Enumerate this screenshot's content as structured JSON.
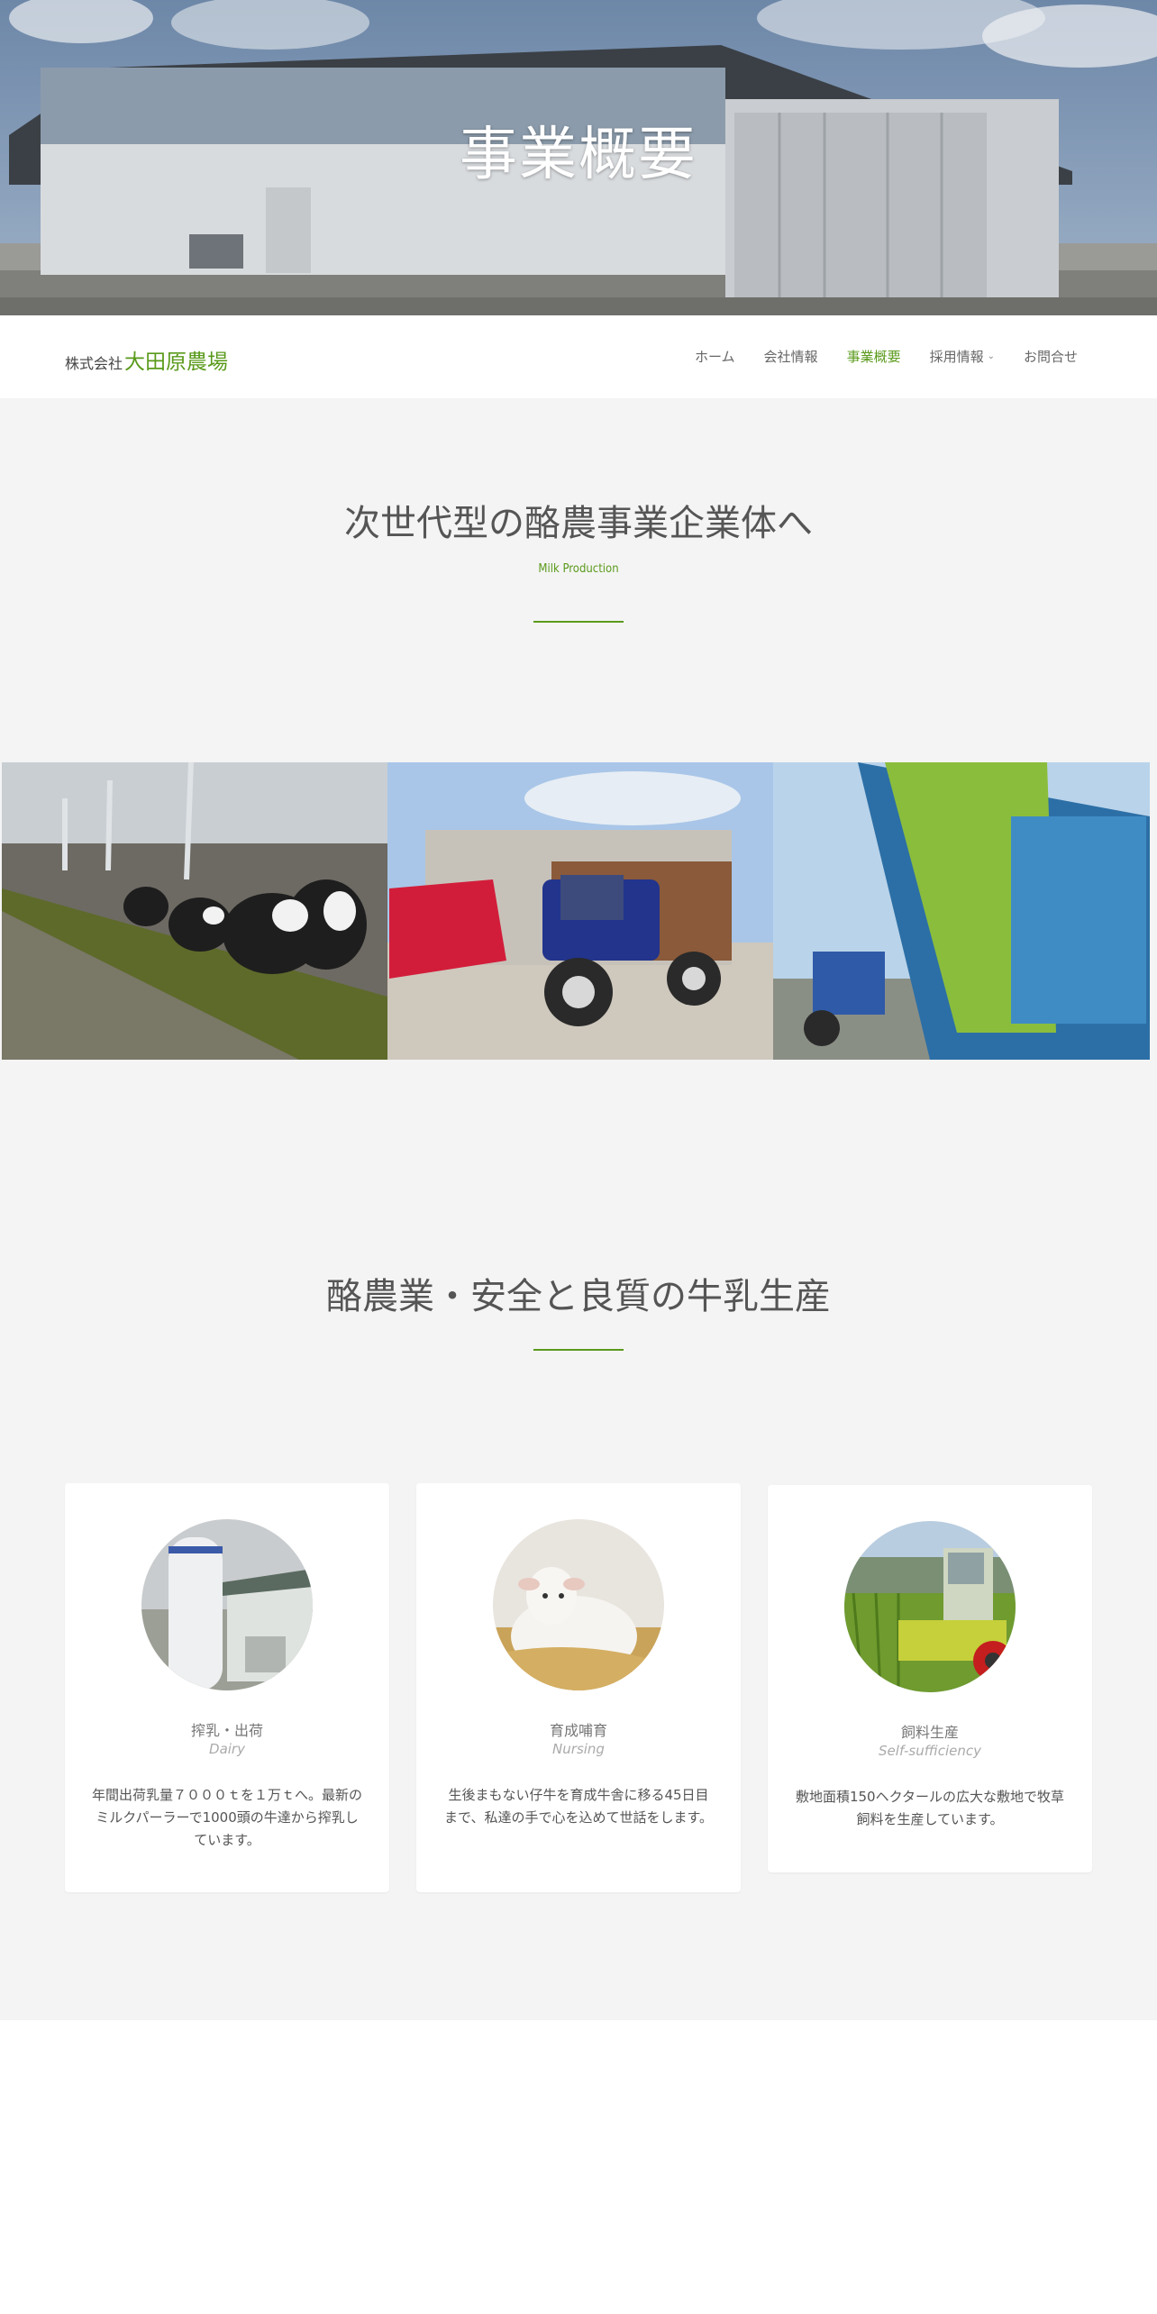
{
  "hero": {
    "title": "事業概要"
  },
  "header": {
    "logo_prefix": "株式会社",
    "logo_name": "大田原農場",
    "menu": [
      {
        "label": "ホーム",
        "active": false
      },
      {
        "label": "会社情報",
        "active": false
      },
      {
        "label": "事業概要",
        "active": true
      },
      {
        "label": "採用情報",
        "active": false,
        "has_dropdown": true
      },
      {
        "label": "お問合せ",
        "active": false
      }
    ]
  },
  "intro": {
    "title": "次世代型の酪農事業企業体へ",
    "subtitle": "Milk Production"
  },
  "section2": {
    "title": "酪農業・安全と良質の牛乳生産"
  },
  "cards": [
    {
      "title": "搾乳・出荷",
      "subtitle": "Dairy",
      "body": "年間出荷乳量７０００ｔを１万ｔへ。最新のミルクパーラーで1000頭の牛達から搾乳しています。"
    },
    {
      "title": "育成哺育",
      "subtitle": "Nursing",
      "body": "生後まもない仔牛を育成牛舎に移る45日目まで、私達の手で心を込めて世話をします。"
    },
    {
      "title": "飼料生産",
      "subtitle": "Self-sufficiency",
      "body": "敷地面積150ヘクタールの広大な敷地で牧草飼料を生産しています。"
    }
  ],
  "colors": {
    "accent": "#5a9a1b",
    "background_gray": "#f4f4f4"
  }
}
